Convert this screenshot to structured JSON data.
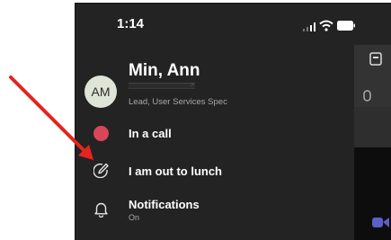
{
  "status_bar": {
    "time": "1:14"
  },
  "profile": {
    "avatar_initials": "AM",
    "name": "Min, Ann",
    "chevron": ">",
    "title": "Lead, User Services Spec"
  },
  "menu": {
    "items": [
      {
        "label": "In a call",
        "icon": "red-presence-dot",
        "color": "#d8465a"
      },
      {
        "label": "I am out to lunch",
        "icon": "edit-status-icon"
      },
      {
        "label": "Notifications",
        "sublabel": "On",
        "icon": "bell-icon"
      }
    ]
  },
  "annotation": {
    "arrow_color": "#e52421"
  }
}
